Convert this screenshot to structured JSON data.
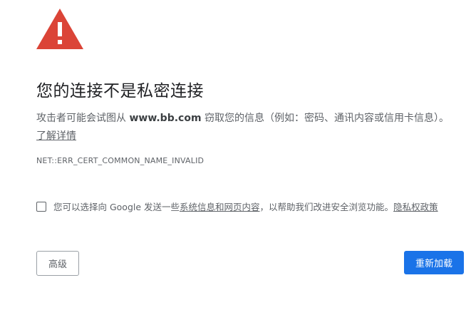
{
  "colors": {
    "warning_red": "#db4437",
    "primary_blue": "#1a73e8",
    "text_main": "#202124",
    "text_secondary": "#5f6368"
  },
  "icon": "warning-triangle-icon",
  "title": "您的连接不是私密连接",
  "description": {
    "prefix": "攻击者可能会试图从 ",
    "domain": "www.bb.com",
    "suffix": " 窃取您的信息（例如：密码、通讯内容或信用卡信息）。",
    "learn_more": "了解详情"
  },
  "error_code": "NET::ERR_CERT_COMMON_NAME_INVALID",
  "optin": {
    "text_before": "您可以选择向 Google 发送一些",
    "link1": "系统信息和网页内容",
    "text_middle": "，以帮助我们改进安全浏览功能。",
    "link2": "隐私权政策",
    "checked": false
  },
  "buttons": {
    "advanced": "高级",
    "reload": "重新加载"
  }
}
